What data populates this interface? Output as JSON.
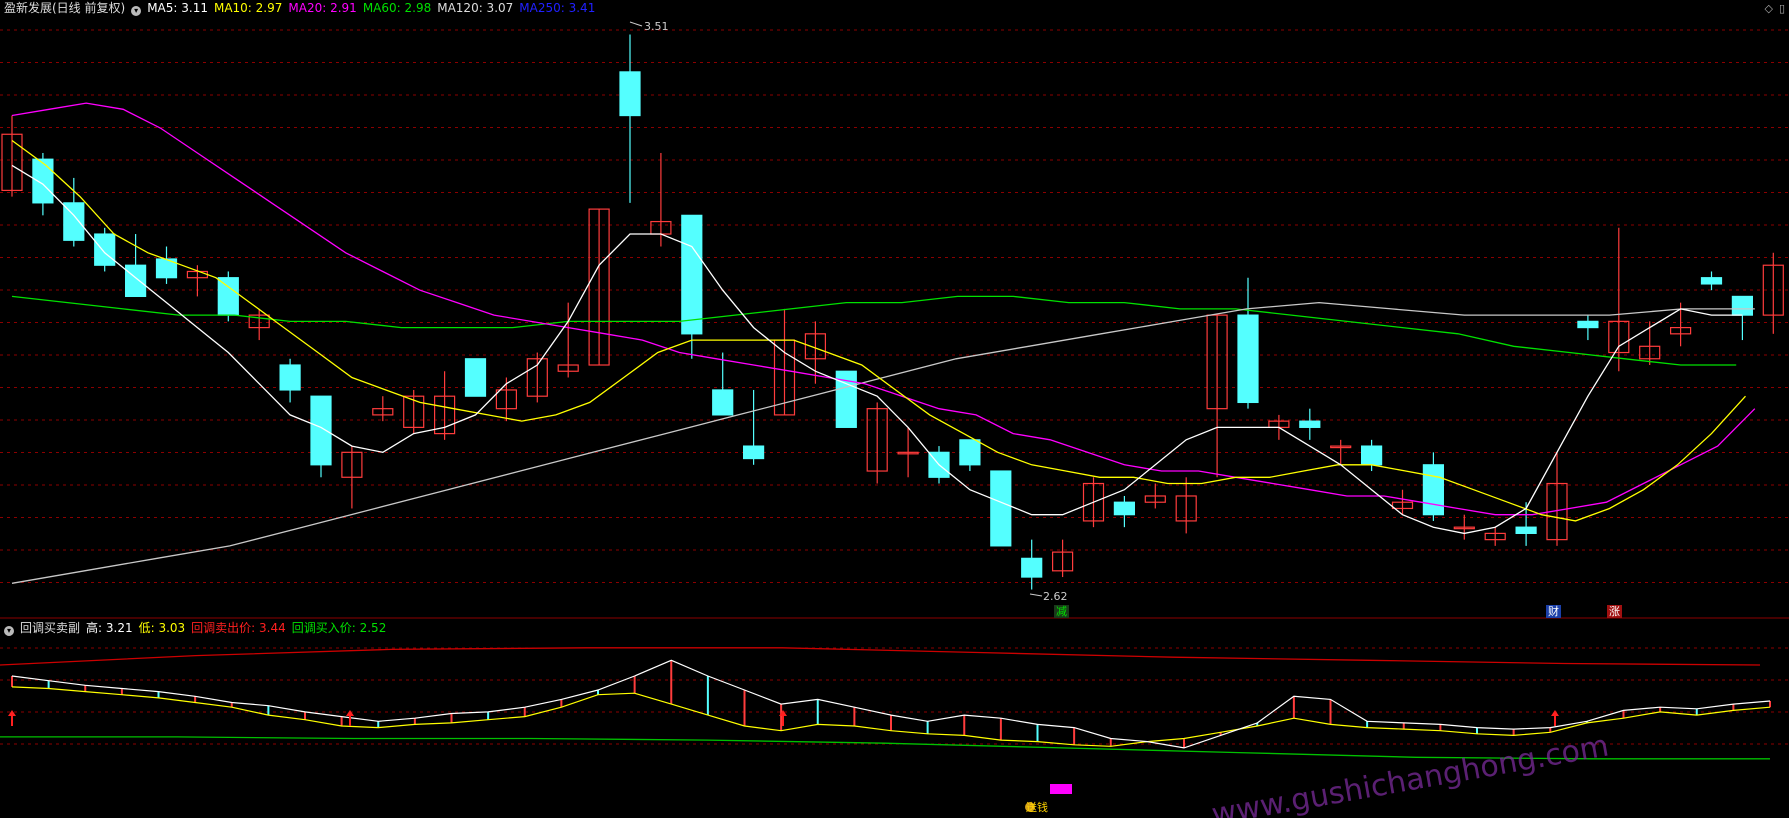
{
  "main_header": {
    "title": "盈新发展(日线 前复权)",
    "ma5": "MA5: 3.11",
    "ma10": "MA10: 2.97",
    "ma20": "MA20: 2.91",
    "ma60": "MA60: 2.98",
    "ma120": "MA120: 3.07",
    "ma250": "MA250: 3.41"
  },
  "sub_header": {
    "title": "回调买卖副",
    "high": "高: 3.21",
    "low": "低: 3.03",
    "sell": "回调卖出价: 3.44",
    "buy": "回调买入价: 2.52"
  },
  "top_right_icons": [
    "diamond-icon",
    "window-icon"
  ],
  "colors": {
    "up": "#ff3c3c",
    "down": "#54ffff",
    "ma5": "#ffffff",
    "ma10": "#ffff00",
    "ma20": "#ff00ff",
    "ma60": "#00e000",
    "ma120": "#c8c8c8",
    "ma250": "#0000ff",
    "grid": "#8b0000",
    "sell_line": "#cc0000",
    "buy_line": "#00c000"
  },
  "annotations": {
    "max_label": "3.51",
    "min_label": "2.62",
    "tag_jian": "减",
    "tag_cai": "财",
    "tag_zhang": "涨",
    "tag_songqian": "送钱",
    "watermark": "www.gushichanghong.com"
  },
  "chart_data": {
    "type": "candlestick",
    "ylim": [
      2.6,
      3.53
    ],
    "candles": [
      {
        "o": 3.26,
        "c": 3.35,
        "h": 3.38,
        "l": 3.25
      },
      {
        "o": 3.31,
        "c": 3.24,
        "h": 3.32,
        "l": 3.22
      },
      {
        "o": 3.24,
        "c": 3.18,
        "h": 3.28,
        "l": 3.17
      },
      {
        "o": 3.19,
        "c": 3.14,
        "h": 3.2,
        "l": 3.13
      },
      {
        "o": 3.14,
        "c": 3.09,
        "h": 3.19,
        "l": 3.09
      },
      {
        "o": 3.15,
        "c": 3.12,
        "h": 3.17,
        "l": 3.11
      },
      {
        "o": 3.12,
        "c": 3.13,
        "h": 3.14,
        "l": 3.09
      },
      {
        "o": 3.12,
        "c": 3.06,
        "h": 3.13,
        "l": 3.05
      },
      {
        "o": 3.04,
        "c": 3.06,
        "h": 3.07,
        "l": 3.02
      },
      {
        "o": 2.98,
        "c": 2.94,
        "h": 2.99,
        "l": 2.92
      },
      {
        "o": 2.93,
        "c": 2.82,
        "h": 2.93,
        "l": 2.8
      },
      {
        "o": 2.8,
        "c": 2.84,
        "h": 2.85,
        "l": 2.75
      },
      {
        "o": 2.9,
        "c": 2.91,
        "h": 2.93,
        "l": 2.89
      },
      {
        "o": 2.88,
        "c": 2.93,
        "h": 2.94,
        "l": 2.87
      },
      {
        "o": 2.87,
        "c": 2.93,
        "h": 2.97,
        "l": 2.86
      },
      {
        "o": 2.99,
        "c": 2.93,
        "h": 2.99,
        "l": 2.93
      },
      {
        "o": 2.91,
        "c": 2.94,
        "h": 2.96,
        "l": 2.89
      },
      {
        "o": 2.93,
        "c": 2.99,
        "h": 3.0,
        "l": 2.92
      },
      {
        "o": 2.97,
        "c": 2.98,
        "h": 3.08,
        "l": 2.96
      },
      {
        "o": 2.98,
        "c": 3.23,
        "h": 3.23,
        "l": 2.98
      },
      {
        "o": 3.45,
        "c": 3.38,
        "h": 3.51,
        "l": 3.24
      },
      {
        "o": 3.19,
        "c": 3.21,
        "h": 3.32,
        "l": 3.17
      },
      {
        "o": 3.22,
        "c": 3.03,
        "h": 3.22,
        "l": 2.99
      },
      {
        "o": 2.94,
        "c": 2.9,
        "h": 3.0,
        "l": 2.9
      },
      {
        "o": 2.85,
        "c": 2.83,
        "h": 2.94,
        "l": 2.82
      },
      {
        "o": 2.9,
        "c": 3.02,
        "h": 3.07,
        "l": 2.9
      },
      {
        "o": 2.99,
        "c": 3.03,
        "h": 3.05,
        "l": 2.95
      },
      {
        "o": 2.97,
        "c": 2.88,
        "h": 2.97,
        "l": 2.88
      },
      {
        "o": 2.81,
        "c": 2.91,
        "h": 2.92,
        "l": 2.79
      },
      {
        "o": 2.84,
        "c": 2.84,
        "h": 2.88,
        "l": 2.8
      },
      {
        "o": 2.84,
        "c": 2.8,
        "h": 2.85,
        "l": 2.79
      },
      {
        "o": 2.86,
        "c": 2.82,
        "h": 2.86,
        "l": 2.81
      },
      {
        "o": 2.81,
        "c": 2.69,
        "h": 2.81,
        "l": 2.69
      },
      {
        "o": 2.67,
        "c": 2.64,
        "h": 2.7,
        "l": 2.62
      },
      {
        "o": 2.65,
        "c": 2.68,
        "h": 2.7,
        "l": 2.64
      },
      {
        "o": 2.73,
        "c": 2.79,
        "h": 2.8,
        "l": 2.72
      },
      {
        "o": 2.76,
        "c": 2.74,
        "h": 2.77,
        "l": 2.72
      },
      {
        "o": 2.76,
        "c": 2.77,
        "h": 2.79,
        "l": 2.75
      },
      {
        "o": 2.73,
        "c": 2.77,
        "h": 2.8,
        "l": 2.71
      },
      {
        "o": 2.91,
        "c": 3.06,
        "h": 3.06,
        "l": 2.8
      },
      {
        "o": 3.06,
        "c": 2.92,
        "h": 3.12,
        "l": 2.91
      },
      {
        "o": 2.88,
        "c": 2.89,
        "h": 2.9,
        "l": 2.86
      },
      {
        "o": 2.89,
        "c": 2.88,
        "h": 2.91,
        "l": 2.86
      },
      {
        "o": 2.85,
        "c": 2.85,
        "h": 2.86,
        "l": 2.82
      },
      {
        "o": 2.85,
        "c": 2.82,
        "h": 2.86,
        "l": 2.81
      },
      {
        "o": 2.75,
        "c": 2.76,
        "h": 2.78,
        "l": 2.74
      },
      {
        "o": 2.82,
        "c": 2.74,
        "h": 2.84,
        "l": 2.73
      },
      {
        "o": 2.72,
        "c": 2.72,
        "h": 2.74,
        "l": 2.7
      },
      {
        "o": 2.7,
        "c": 2.71,
        "h": 2.72,
        "l": 2.69
      },
      {
        "o": 2.72,
        "c": 2.71,
        "h": 2.76,
        "l": 2.69
      },
      {
        "o": 2.7,
        "c": 2.79,
        "h": 2.84,
        "l": 2.69
      },
      {
        "o": 3.05,
        "c": 3.04,
        "h": 3.06,
        "l": 3.02
      },
      {
        "o": 3.0,
        "c": 3.05,
        "h": 3.2,
        "l": 2.97
      },
      {
        "o": 2.99,
        "c": 3.01,
        "h": 3.05,
        "l": 2.98
      },
      {
        "o": 3.03,
        "c": 3.04,
        "h": 3.08,
        "l": 3.01
      },
      {
        "o": 3.12,
        "c": 3.11,
        "h": 3.13,
        "l": 3.1
      },
      {
        "o": 3.09,
        "c": 3.06,
        "h": 3.09,
        "l": 3.02
      },
      {
        "o": 3.06,
        "c": 3.14,
        "h": 3.16,
        "l": 3.03
      }
    ],
    "ma5": [
      3.3,
      3.27,
      3.22,
      3.16,
      3.12,
      3.08,
      3.04,
      3.0,
      2.95,
      2.9,
      2.88,
      2.85,
      2.84,
      2.87,
      2.88,
      2.9,
      2.95,
      2.98,
      3.05,
      3.14,
      3.19,
      3.19,
      3.17,
      3.1,
      3.04,
      3.0,
      2.97,
      2.95,
      2.93,
      2.88,
      2.82,
      2.78,
      2.76,
      2.74,
      2.74,
      2.76,
      2.78,
      2.82,
      2.86,
      2.88,
      2.88,
      2.88,
      2.85,
      2.82,
      2.78,
      2.74,
      2.72,
      2.71,
      2.72,
      2.75,
      2.84,
      2.93,
      3.01,
      3.04,
      3.07,
      3.06,
      3.06
    ],
    "ma10": [
      3.34,
      3.3,
      3.25,
      3.19,
      3.16,
      3.14,
      3.12,
      3.08,
      3.04,
      3.0,
      2.96,
      2.94,
      2.92,
      2.91,
      2.9,
      2.89,
      2.9,
      2.92,
      2.96,
      3.0,
      3.02,
      3.02,
      3.02,
      3.02,
      3.0,
      2.98,
      2.94,
      2.9,
      2.87,
      2.84,
      2.82,
      2.81,
      2.8,
      2.8,
      2.79,
      2.79,
      2.8,
      2.8,
      2.81,
      2.82,
      2.82,
      2.81,
      2.8,
      2.78,
      2.76,
      2.74,
      2.73,
      2.75,
      2.78,
      2.82,
      2.87,
      2.93
    ],
    "ma20": [
      3.38,
      3.39,
      3.4,
      3.39,
      3.36,
      3.32,
      3.28,
      3.24,
      3.2,
      3.16,
      3.13,
      3.1,
      3.08,
      3.06,
      3.05,
      3.04,
      3.03,
      3.02,
      3.0,
      2.99,
      2.98,
      2.97,
      2.96,
      2.95,
      2.93,
      2.91,
      2.9,
      2.87,
      2.86,
      2.84,
      2.82,
      2.81,
      2.81,
      2.8,
      2.79,
      2.78,
      2.77,
      2.77,
      2.76,
      2.75,
      2.74,
      2.74,
      2.75,
      2.76,
      2.79,
      2.82,
      2.85,
      2.91
    ],
    "ma60": [
      3.09,
      3.08,
      3.07,
      3.06,
      3.06,
      3.05,
      3.05,
      3.04,
      3.04,
      3.04,
      3.05,
      3.05,
      3.05,
      3.06,
      3.07,
      3.08,
      3.08,
      3.09,
      3.09,
      3.08,
      3.08,
      3.07,
      3.07,
      3.06,
      3.05,
      3.04,
      3.03,
      3.01,
      3.0,
      2.99,
      2.98,
      2.98
    ],
    "ma120": [
      2.63,
      2.65,
      2.67,
      2.69,
      2.72,
      2.75,
      2.78,
      2.81,
      2.84,
      2.87,
      2.9,
      2.93,
      2.96,
      2.99,
      3.01,
      3.03,
      3.05,
      3.07,
      3.08,
      3.07,
      3.06,
      3.06,
      3.06,
      3.07,
      3.07
    ],
    "sub_ylim": [
      2.5,
      3.6
    ],
    "sub_upper": [
      3.37,
      3.34,
      3.31,
      3.29,
      3.27,
      3.24,
      3.2,
      3.18,
      3.14,
      3.11,
      3.08,
      3.1,
      3.13,
      3.14,
      3.17,
      3.22,
      3.28,
      3.37,
      3.47,
      3.37,
      3.28,
      3.19,
      3.22,
      3.17,
      3.12,
      3.08,
      3.12,
      3.1,
      3.06,
      3.04,
      2.97,
      2.95,
      2.91,
      2.99,
      3.07,
      3.24,
      3.22,
      3.08,
      3.07,
      3.06,
      3.04,
      3.03,
      3.04,
      3.08,
      3.15,
      3.17,
      3.16,
      3.19,
      3.21
    ],
    "sub_lower": [
      3.3,
      3.29,
      3.27,
      3.25,
      3.23,
      3.2,
      3.17,
      3.12,
      3.09,
      3.05,
      3.04,
      3.06,
      3.07,
      3.09,
      3.11,
      3.17,
      3.25,
      3.26,
      3.19,
      3.12,
      3.05,
      3.02,
      3.06,
      3.05,
      3.02,
      3.0,
      2.99,
      2.96,
      2.95,
      2.93,
      2.92,
      2.95,
      2.97,
      3.01,
      3.05,
      3.1,
      3.06,
      3.04,
      3.03,
      3.02,
      3.0,
      2.99,
      3.01,
      3.07,
      3.1,
      3.14,
      3.12,
      3.15,
      3.17
    ],
    "sub_sell": [
      3.44,
      3.5,
      3.54,
      3.55,
      3.55,
      3.52,
      3.49,
      3.47,
      3.45,
      3.44
    ],
    "sub_buy": [
      2.98,
      2.98,
      2.97,
      2.97,
      2.96,
      2.94,
      2.91,
      2.88,
      2.85,
      2.84,
      2.84
    ]
  }
}
